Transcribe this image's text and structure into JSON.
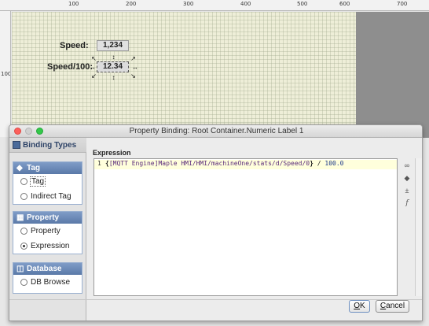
{
  "designer": {
    "ruler_top": [
      "100",
      "200",
      "300",
      "400",
      "500",
      "600",
      "700"
    ],
    "ruler_left": [
      "100"
    ],
    "speed_label": "Speed:",
    "speed_value": "1,234",
    "speed100_label": "Speed/100:",
    "speed100_value": "12.34"
  },
  "dialog": {
    "title": "Property Binding: Root Container.Numeric Label 1",
    "binding_types_header": "Binding Types",
    "groups": {
      "tag": {
        "label": "Tag",
        "options": [
          {
            "label": "Tag",
            "selected": false
          },
          {
            "label": "Indirect Tag",
            "selected": false
          }
        ]
      },
      "property": {
        "label": "Property",
        "options": [
          {
            "label": "Property",
            "selected": false
          },
          {
            "label": "Expression",
            "selected": true
          }
        ]
      },
      "database": {
        "label": "Database",
        "options": [
          {
            "label": "DB Browse",
            "selected": false
          }
        ]
      }
    },
    "expression_label": "Expression",
    "expression": {
      "line_number": "1",
      "open_brace": "{",
      "tag_path": "[MQTT Engine]Maple HMI/HMI/machineOne/stats/d/Speed/0",
      "close_brace": "}",
      "operator": " / ",
      "divisor": "100.0"
    },
    "side_tools": [
      "link-icon",
      "tag-icon",
      "add-operator-icon",
      "function-icon"
    ],
    "buttons": {
      "ok_mnemonic": "O",
      "ok_rest": "K",
      "cancel_mnemonic": "C",
      "cancel_rest": "ancel"
    }
  }
}
